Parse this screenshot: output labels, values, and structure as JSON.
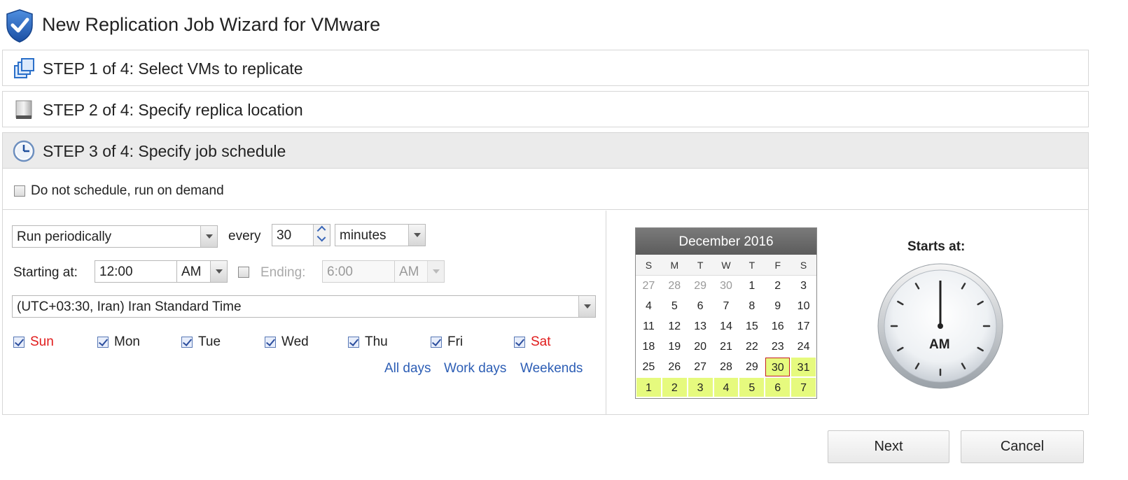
{
  "window": {
    "title": "New Replication Job Wizard for VMware"
  },
  "steps": [
    {
      "label": "STEP 1 of 4: Select VMs to replicate"
    },
    {
      "label": "STEP 2 of 4: Specify replica location"
    },
    {
      "label": "STEP 3 of 4: Specify job schedule"
    }
  ],
  "schedule": {
    "no_schedule_label": "Do not schedule, run on demand",
    "no_schedule_checked": false,
    "mode": "Run periodically",
    "every_label": "every",
    "interval": "30",
    "interval_unit": "minutes",
    "starting_label": "Starting at:",
    "start_time": "12:00",
    "start_ampm": "AM",
    "ending_label": "Ending:",
    "ending_checked": false,
    "end_time": "6:00",
    "end_ampm": "AM",
    "timezone": "(UTC+03:30, Iran) Iran Standard Time",
    "days": [
      {
        "label": "Sun",
        "checked": true
      },
      {
        "label": "Mon",
        "checked": true
      },
      {
        "label": "Tue",
        "checked": true
      },
      {
        "label": "Wed",
        "checked": true
      },
      {
        "label": "Thu",
        "checked": true
      },
      {
        "label": "Fri",
        "checked": true
      },
      {
        "label": "Sat",
        "checked": true
      }
    ],
    "quick_links": {
      "all": "All days",
      "work": "Work days",
      "weekends": "Weekends"
    }
  },
  "calendar": {
    "title": "December 2016",
    "weekdays": [
      "S",
      "M",
      "T",
      "W",
      "T",
      "F",
      "S"
    ],
    "cells": [
      "27",
      "28",
      "29",
      "30",
      "1",
      "2",
      "3",
      "4",
      "5",
      "6",
      "7",
      "8",
      "9",
      "10",
      "11",
      "12",
      "13",
      "14",
      "15",
      "16",
      "17",
      "18",
      "19",
      "20",
      "21",
      "22",
      "23",
      "24",
      "25",
      "26",
      "27",
      "28",
      "29",
      "30",
      "31",
      "1",
      "2",
      "3",
      "4",
      "5",
      "6",
      "7"
    ],
    "other_month_cells": [
      0,
      1,
      2,
      3
    ],
    "highlighted_cells": [
      33,
      34,
      35,
      36,
      37,
      38,
      39,
      40,
      41
    ],
    "selected_cell": 33
  },
  "clock": {
    "starts_label": "Starts at:",
    "ampm": "AM"
  },
  "footer": {
    "next_label": "Next",
    "cancel_label": "Cancel"
  },
  "colors": {
    "link": "#2d5eb5",
    "weekend": "#e01b1b",
    "calendar_highlight": "#e6fa7e"
  }
}
